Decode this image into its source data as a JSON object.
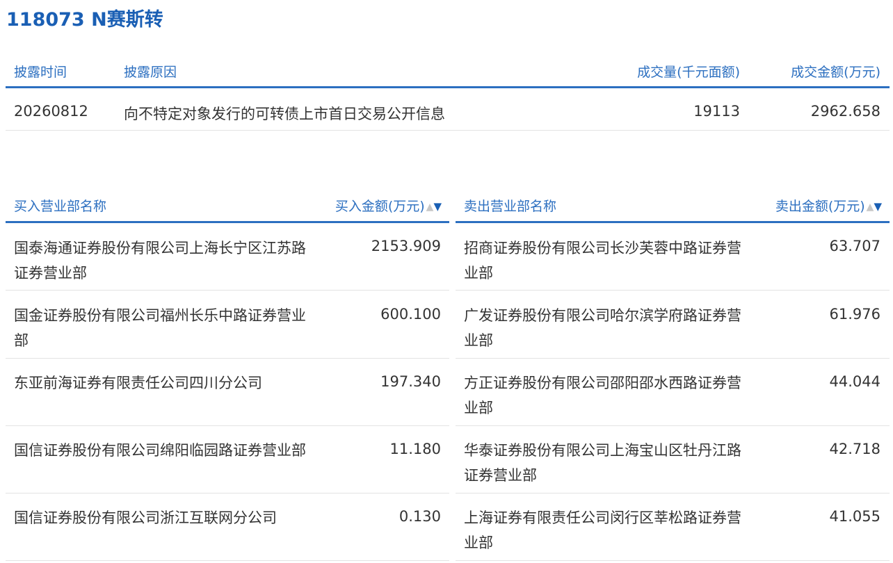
{
  "title": "118073 N赛斯转",
  "summary": {
    "headers": {
      "date": "披露时间",
      "reason": "披露原因",
      "volume": "成交量(千元面额)",
      "amount": "成交金额(万元)"
    },
    "row": {
      "date": "20260812",
      "reason": "向不特定对象发行的可转债上市首日交易公开信息",
      "volume": "19113",
      "amount": "2962.658"
    }
  },
  "buy": {
    "header_name": "买入营业部名称",
    "header_amount": "买入金额(万元)",
    "rows": [
      {
        "name": "国泰海通证券股份有限公司上海长宁区江苏路证券营业部",
        "amount": "2153.909"
      },
      {
        "name": "国金证券股份有限公司福州长乐中路证券营业部",
        "amount": "600.100"
      },
      {
        "name": "东亚前海证券有限责任公司四川分公司",
        "amount": "197.340"
      },
      {
        "name": "国信证券股份有限公司绵阳临园路证券营业部",
        "amount": "11.180"
      },
      {
        "name": "国信证券股份有限公司浙江互联网分公司",
        "amount": "0.130"
      }
    ]
  },
  "sell": {
    "header_name": "卖出营业部名称",
    "header_amount": "卖出金额(万元)",
    "rows": [
      {
        "name": "招商证券股份有限公司长沙芙蓉中路证券营业部",
        "amount": "63.707"
      },
      {
        "name": "广发证券股份有限公司哈尔滨学府路证券营业部",
        "amount": "61.976"
      },
      {
        "name": "方正证券股份有限公司邵阳邵水西路证券营业部",
        "amount": "44.044"
      },
      {
        "name": "华泰证券股份有限公司上海宝山区牡丹江路证券营业部",
        "amount": "42.718"
      },
      {
        "name": "上海证券有限责任公司闵行区莘松路证券营业部",
        "amount": "41.055"
      }
    ]
  },
  "icons": {
    "sort_up": "▲",
    "sort_down": "▼"
  },
  "colors": {
    "accent": "#2c6fc0",
    "title": "#1a5fb4",
    "text": "#333333",
    "divider": "#e3e3e3"
  }
}
